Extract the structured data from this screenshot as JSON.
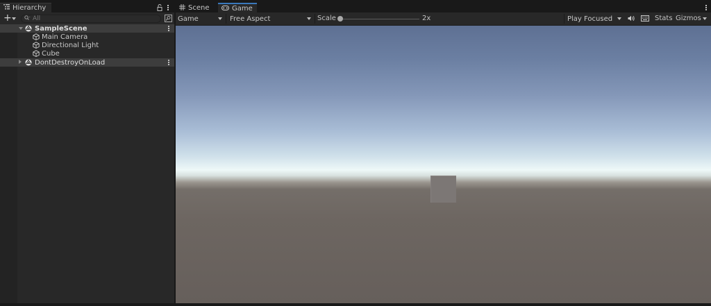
{
  "hierarchy": {
    "tab_label": "Hierarchy",
    "add_label": "+",
    "search_placeholder": "All",
    "items": [
      {
        "label": "SampleScene",
        "type": "scene",
        "expanded": true
      },
      {
        "label": "Main Camera",
        "type": "gameobject"
      },
      {
        "label": "Directional Light",
        "type": "gameobject"
      },
      {
        "label": "Cube",
        "type": "gameobject"
      },
      {
        "label": "DontDestroyOnLoad",
        "type": "scene",
        "expanded": false
      }
    ]
  },
  "game_panel": {
    "tabs": [
      {
        "label": "Scene",
        "icon": "grid-icon",
        "active": false
      },
      {
        "label": "Game",
        "icon": "gamepad-icon",
        "active": true
      }
    ],
    "toolbar": {
      "display": "Game",
      "aspect": "Free Aspect",
      "scale_label": "Scale",
      "scale_value": "2x",
      "scale_fraction": 0.0,
      "play_mode": "Play Focused",
      "stats_label": "Stats",
      "gizmos_label": "Gizmos"
    }
  },
  "colors": {
    "accent_tab": "#3a79bb",
    "panel_bg": "#282828",
    "sky_top": "#5e7093",
    "horizon": "#eef8f8",
    "ground": "#665f5b"
  }
}
